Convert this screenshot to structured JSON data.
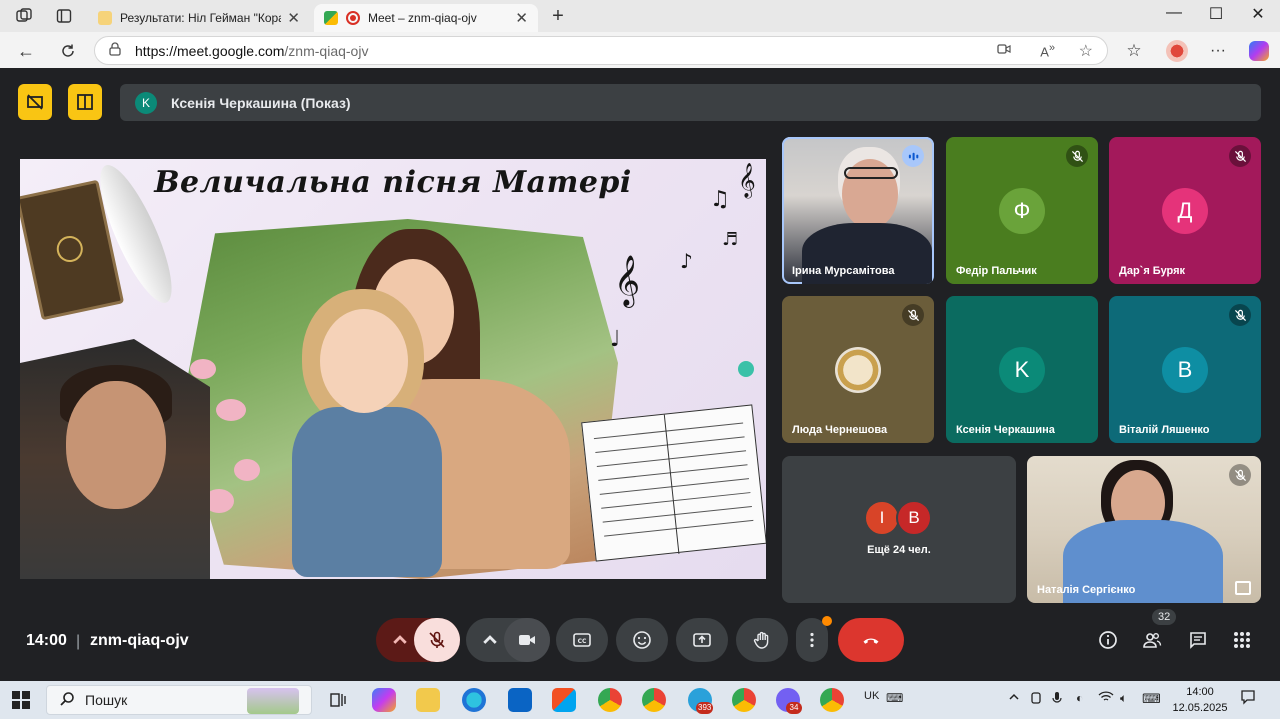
{
  "browser": {
    "tabs": [
      {
        "label": "Результати: Ніл Гейман \"Коралін",
        "active": false
      },
      {
        "label": "Meet – znm-qiaq-ojv",
        "active": true
      }
    ],
    "new_tab": "+",
    "window_controls": {
      "minimize": "—",
      "maximize": "☐",
      "close": "✕"
    },
    "address": {
      "host": "https://meet.google.com",
      "path": "/znm-qiaq-ojv"
    }
  },
  "meet": {
    "presenter": {
      "avatar_letter": "K",
      "title": "Ксенія Черкашина (Показ)"
    },
    "slide": {
      "title": "Величальна пісня Матері"
    },
    "tiles": [
      {
        "name": "Ірина Мурсамітова",
        "type": "video",
        "mic": "speaking"
      },
      {
        "name": "Федір Пальчик",
        "type": "avatar",
        "letter": "Ф",
        "bg": "#4a7d1f",
        "avatar_color": "#6aa33a",
        "mic": "muted"
      },
      {
        "name": "Дар`я Буряк",
        "type": "avatar",
        "letter": "Д",
        "bg": "#a3195b",
        "avatar_color": "#e5337a",
        "mic": "muted"
      },
      {
        "name": "Люда Чернешова",
        "type": "photo",
        "bg": "#6b5d3a",
        "mic": "muted"
      },
      {
        "name": "Ксенія Черкашина",
        "type": "avatar",
        "letter": "K",
        "bg": "#0b6b60",
        "avatar_color": "#0b8a78",
        "mic": "none"
      },
      {
        "name": "Віталій Ляшенко",
        "type": "avatar",
        "letter": "В",
        "bg": "#0d6a78",
        "avatar_color": "#0e8ea3",
        "mic": "muted"
      },
      {
        "name": "Наталія Сергієнко",
        "type": "video",
        "mic": "muted"
      }
    ],
    "others": {
      "letters": [
        "І",
        "В"
      ],
      "label": "Ещё 24 чел."
    },
    "bottom": {
      "time": "14:00",
      "separator": "|",
      "meeting_code": "znm-qiaq-ojv",
      "participants_count": "32"
    }
  },
  "taskbar": {
    "search_label": "Пошук",
    "badges": [
      "393",
      "34"
    ],
    "language": "UK",
    "time": "14:00",
    "date": "12.05.2025"
  }
}
